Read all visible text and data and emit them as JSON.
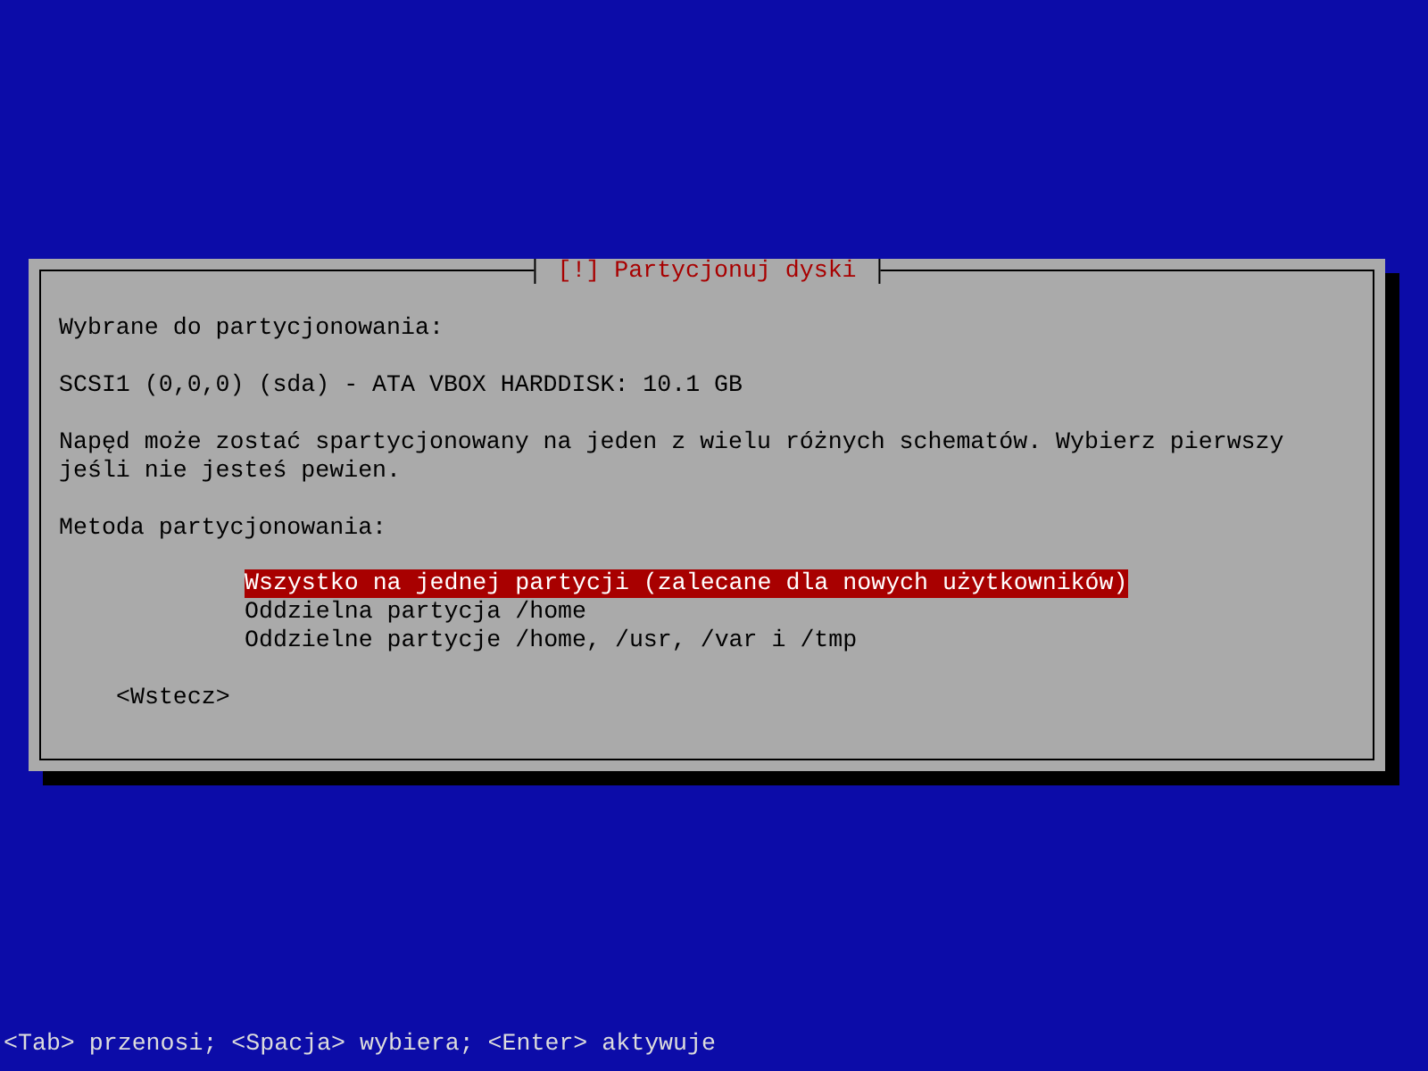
{
  "dialog": {
    "title": "[!] Partycjonuj dyski",
    "paragraphs": [
      "Wybrane do partycjonowania:",
      "SCSI1 (0,0,0) (sda) - ATA VBOX HARDDISK: 10.1 GB",
      "Napęd może zostać spartycjonowany na jeden z wielu różnych schematów. Wybierz pierwszy jeśli nie jesteś pewien.",
      "Metoda partycjonowania:"
    ],
    "options": [
      {
        "label": "Wszystko na jednej partycji (zalecane dla nowych użytkowników)",
        "selected": true
      },
      {
        "label": "Oddzielna partycja /home",
        "selected": false
      },
      {
        "label": "Oddzielne partycje /home, /usr, /var i /tmp",
        "selected": false
      }
    ],
    "back_button": "<Wstecz>"
  },
  "status_bar": "<Tab> przenosi; <Spacja> wybiera; <Enter> aktywuje"
}
